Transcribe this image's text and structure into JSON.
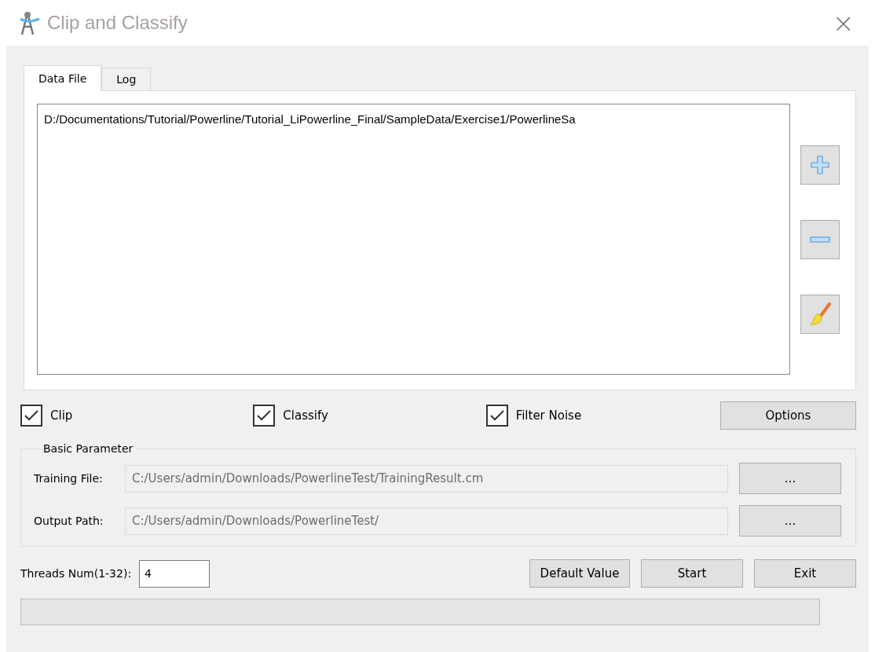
{
  "window": {
    "title": "Clip and Classify",
    "close": "×"
  },
  "tabs": [
    {
      "label": "Data File",
      "selected": true
    },
    {
      "label": "Log",
      "selected": false
    }
  ],
  "data_files": [
    "D:/Documentations/Tutorial/Powerline/Tutorial_LiPowerline_Final/SampleData/Exercise1/PowerlineSa"
  ],
  "options": [
    {
      "label": "Clip",
      "checked": true
    },
    {
      "label": "Classify",
      "checked": true
    },
    {
      "label": "Filter Noise",
      "checked": true
    }
  ],
  "options_button": "Options",
  "basic_parameter": {
    "title": "Basic Parameter",
    "fields": [
      {
        "label": "Training File:",
        "value": "C:/Users/admin/Downloads/PowerlineTest/TrainingResult.cm",
        "browse": "..."
      },
      {
        "label": "Output Path:",
        "value": "C:/Users/admin/Downloads/PowerlineTest/",
        "browse": "..."
      }
    ]
  },
  "threads": {
    "label": "Threads Num(1-32):",
    "value": "4"
  },
  "buttons": [
    "Default Value",
    "Start",
    "Exit"
  ]
}
